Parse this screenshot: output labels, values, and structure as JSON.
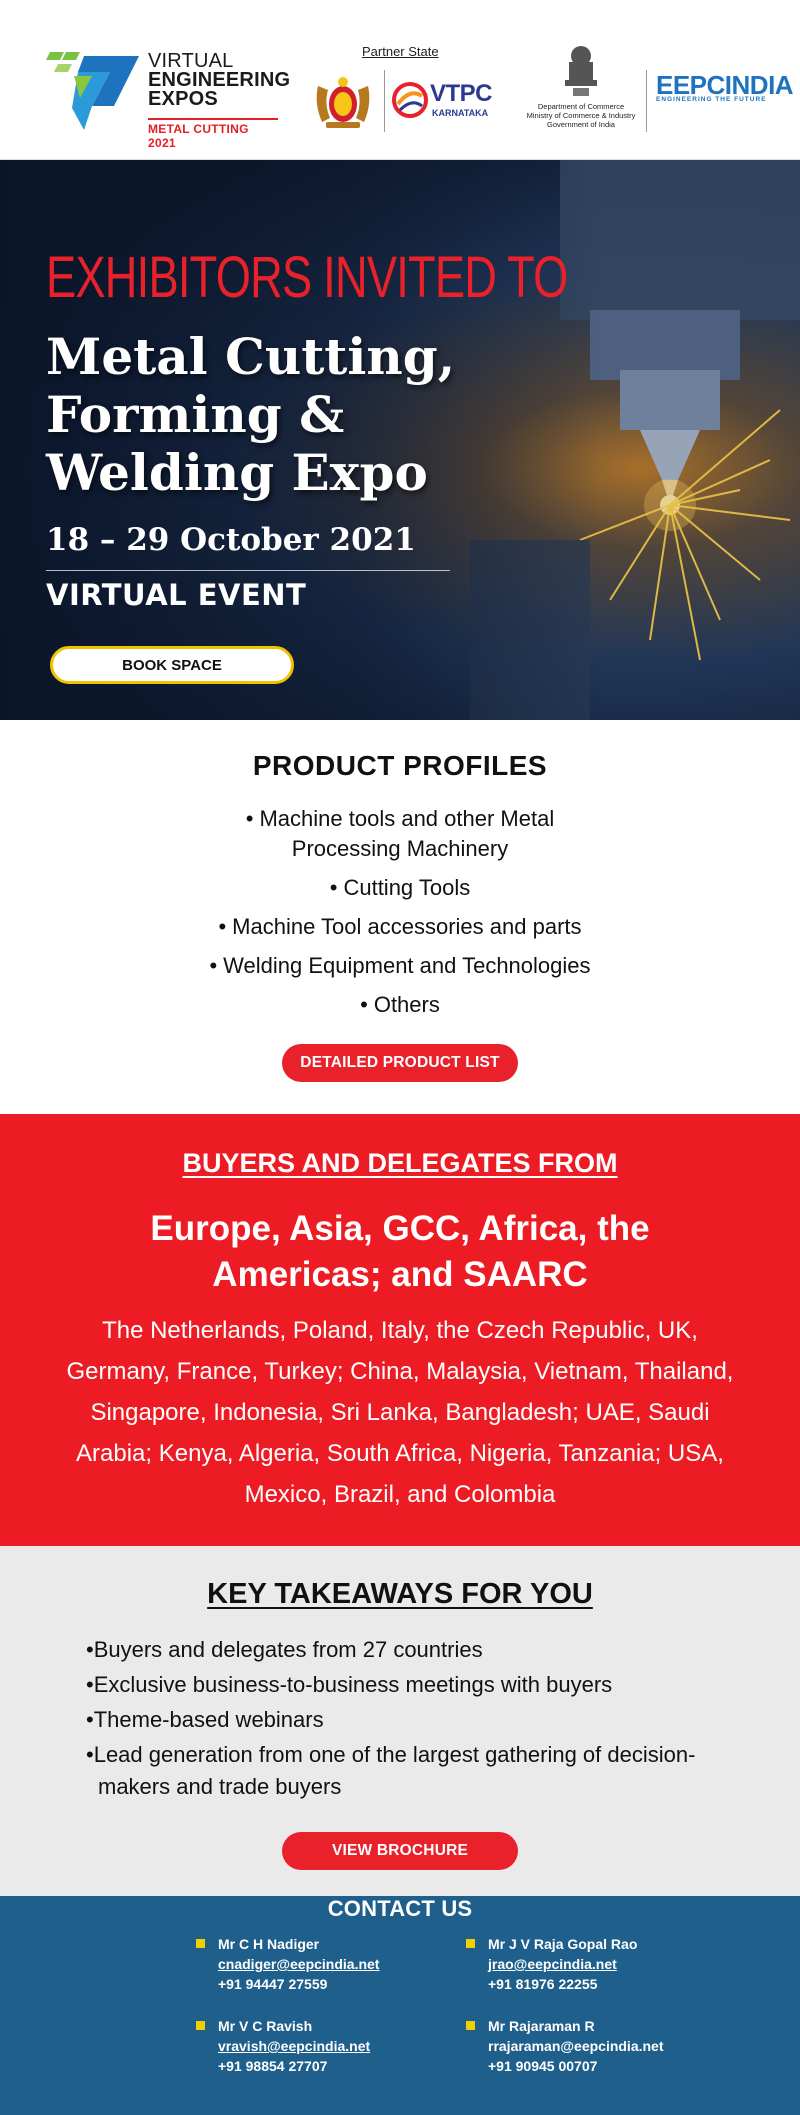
{
  "header": {
    "logo_lines": [
      "VIRTUAL",
      "ENGINEERING",
      "EXPOS"
    ],
    "logo_sub": "METAL CUTTING 2021",
    "partner_label": "Partner State",
    "vtpc_name": "VTPC",
    "vtpc_sub": "KARNATAKA",
    "gov_text": [
      "Department of Commerce",
      "Ministry of Commerce & Industry",
      "Government of India"
    ],
    "eepc_name": "EEPCINDIA",
    "eepc_tagline": "ENGINEERING THE FUTURE"
  },
  "hero": {
    "invite": "EXHIBITORS INVITED TO",
    "title_lines": [
      "Metal Cutting,",
      "Forming &",
      "Welding Expo"
    ],
    "date": "18 – 29 October 2021",
    "event_type": "VIRTUAL EVENT",
    "book_button": "BOOK SPACE"
  },
  "products": {
    "heading": "PRODUCT PROFILES",
    "items": [
      "Machine tools and other Metal",
      "Processing Machinery",
      "Cutting Tools",
      "Machine Tool accessories and parts",
      "Welding Equipment and Technologies",
      "Others"
    ],
    "button": "DETAILED PRODUCT  LIST"
  },
  "buyers": {
    "heading": "BUYERS AND DELEGATES FROM",
    "regions": "Europe, Asia, GCC, Africa, the Americas;  and SAARC",
    "countries": "The Netherlands, Poland, Italy, the Czech Republic, UK, Germany, France, Turkey; China, Malaysia, Vietnam, Thailand, Singapore, Indonesia, Sri Lanka, Bangladesh; UAE, Saudi Arabia; Kenya, Algeria, South Africa, Nigeria, Tanzania; USA, Mexico, Brazil, and Colombia"
  },
  "takeaways": {
    "heading": "KEY TAKEAWAYS FOR YOU",
    "items": [
      "•Buyers and delegates from 27 countries",
      "•Exclusive business-to-business meetings with buyers",
      "•Theme-based webinars",
      "•Lead generation from one of the largest gathering of decision-makers and trade buyers"
    ],
    "button": "VIEW BROCHURE"
  },
  "contact": {
    "heading": "CONTACT US",
    "people": [
      {
        "name": "Mr C H Nadiger",
        "email": "cnadiger@eepcindia.net",
        "phone": "+91 94447 27559"
      },
      {
        "name": "Mr J V Raja Gopal Rao",
        "email": "jrao@eepcindia.net",
        "phone": "+91 81976 22255"
      },
      {
        "name": "Mr V C Ravish",
        "email": "vravish@eepcindia.net",
        "phone": "+91 98854 27707"
      },
      {
        "name": "Mr Rajaraman R",
        "email": "rrajaraman@eepcindia.net",
        "phone": "+91 90945 00707"
      }
    ]
  },
  "colors": {
    "brand_red": "#ed1c24",
    "contact_blue": "#1f5f8c",
    "eepc_blue": "#1e73be",
    "button_border_yellow": "#f2c200"
  }
}
